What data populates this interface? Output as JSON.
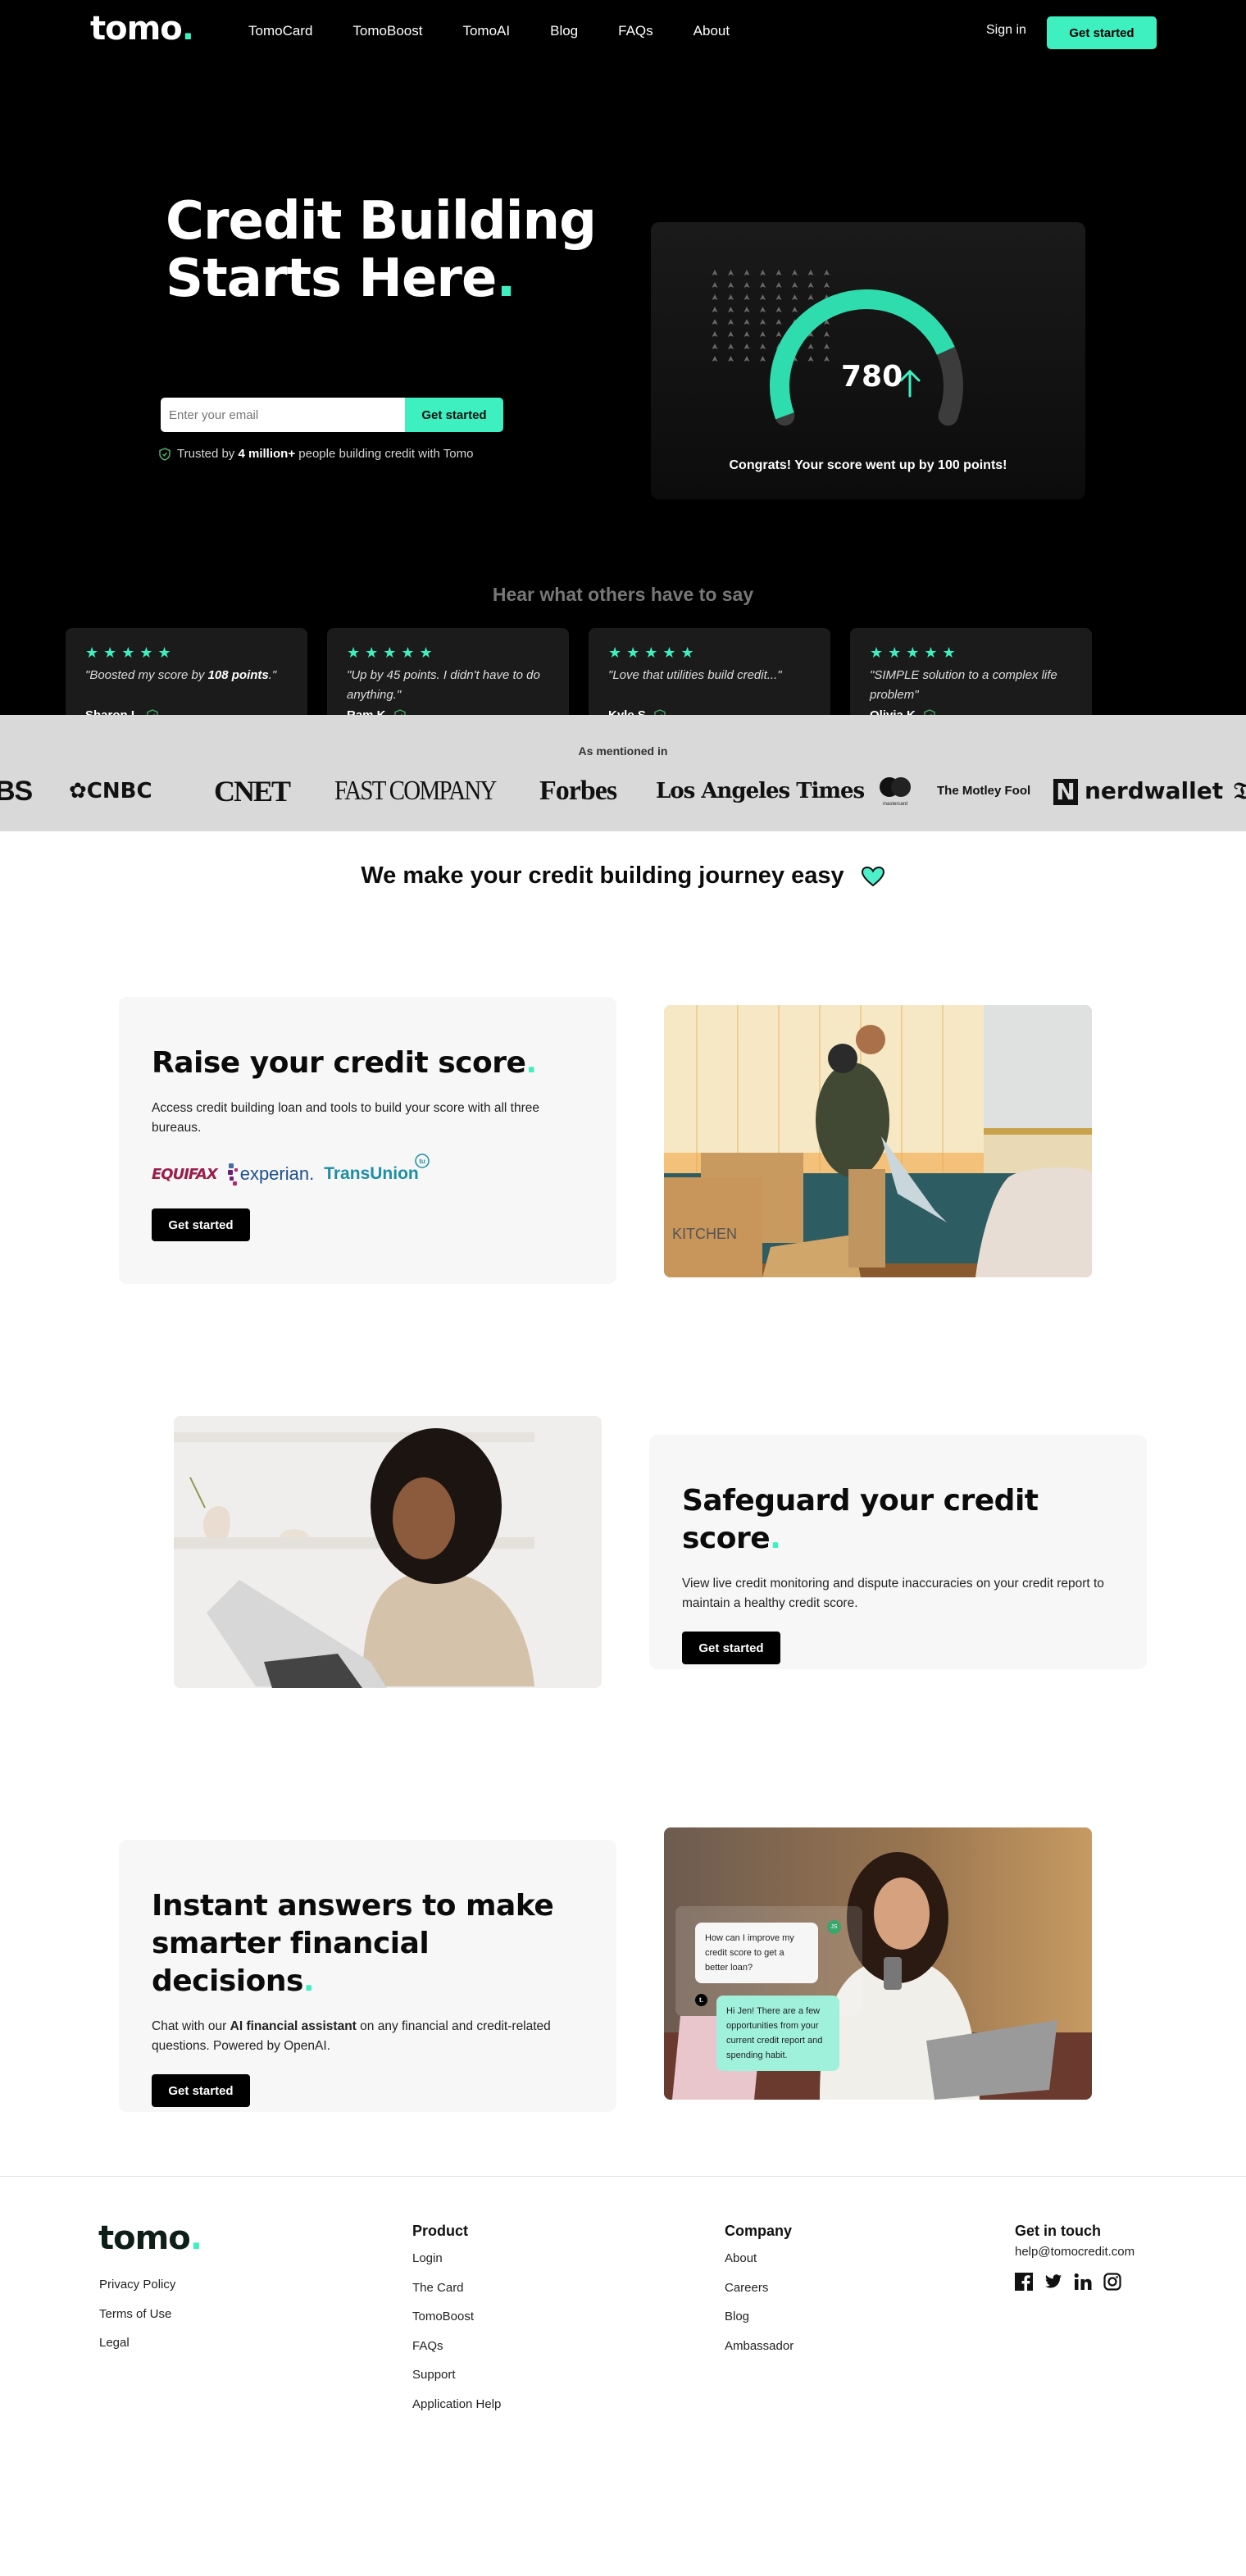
{
  "nav": {
    "logo": "tomo",
    "logo_dot": ".",
    "links": [
      "TomoCard",
      "TomoBoost",
      "TomoAI",
      "Blog",
      "FAQs",
      "About"
    ],
    "sign_in": "Sign in",
    "cta": "Get started"
  },
  "hero": {
    "title_line1": "Credit Building",
    "title_line2": "Starts Here",
    "title_dot": ".",
    "email_placeholder": "Enter your email",
    "email_value": "",
    "email_button": "Get started",
    "trusted_prefix": "Trusted by ",
    "trusted_bold": "4 million+",
    "trusted_suffix": " people building credit with Tomo",
    "score_widget": {
      "score": "780",
      "trend_icon": "arrow-up-icon",
      "gauge_fill_fraction": 0.8,
      "message": "Congrats! Your score went up by 100 points!"
    }
  },
  "testimonials": {
    "title": "Hear what others have to say",
    "rating_stars": 5,
    "items": [
      {
        "stars": "★★★★★",
        "quote_pre": "\"Boosted my score by ",
        "quote_bold": "108 points",
        "quote_post": ".\"",
        "author": "Sharon L."
      },
      {
        "stars": "★★★★★",
        "quote_pre": "\"Up by 45 points. I didn't have to do anything.\"",
        "quote_bold": "",
        "quote_post": "",
        "author": "Ram K."
      },
      {
        "stars": "★★★★★",
        "quote_pre": "\"Love that utilities build credit...\"",
        "quote_bold": "",
        "quote_post": "",
        "author": "Kyle S."
      },
      {
        "stars": "★★★★★",
        "quote_pre": "\"SIMPLE solution to a complex life problem\"",
        "quote_bold": "",
        "quote_post": "",
        "author": "Olivia K."
      }
    ]
  },
  "press": {
    "title": "As mentioned in",
    "logos": [
      "CBS",
      "CNBC",
      "CNET",
      "FAST COMPANY",
      "Forbes",
      "Los Angeles Times",
      "mastercard",
      "The Motley Fool",
      "nerdwallet",
      "The New York Times"
    ]
  },
  "easy": {
    "title": "We make your credit building journey easy",
    "icon": "heart-icon"
  },
  "features": [
    {
      "title": "Raise your credit score",
      "dot": ".",
      "body": "Access credit building loan and tools to build your score with all three bureaus.",
      "bureaus": [
        "EQUIFAX",
        "experian.",
        "TransUnion"
      ],
      "button": "Get started",
      "image": "couple-hugging-moving-boxes-photo"
    },
    {
      "title": "Safeguard your credit score",
      "dot": ".",
      "body": "View live credit monitoring and dispute inaccuracies on your credit report to maintain a healthy credit score.",
      "button": "Get started",
      "image": "woman-using-laptop-photo"
    },
    {
      "title_line1": "Instant answers to make",
      "title_line2": "smarter financial decisions",
      "dot": ".",
      "body_pre": "Chat with our ",
      "body_bold": "AI financial assistant",
      "body_post": " on any financial and credit-related questions. Powered by OpenAI.",
      "button": "Get started",
      "image": "woman-with-phone-photo",
      "chat": {
        "user_avatar": "JS",
        "user_msg": "How can I improve my credit score to get a better loan?",
        "bot_avatar": "t.",
        "bot_msg": "Hi Jen! There are a few opportunities from your current credit report and spending habit."
      }
    }
  ],
  "footer": {
    "logo": "tomo",
    "logo_dot": ".",
    "legal_links": [
      "Privacy Policy",
      "Terms of Use",
      "Legal"
    ],
    "product": {
      "title": "Product",
      "links": [
        "Login",
        "The Card",
        "TomoBoost",
        "FAQs",
        "Support",
        "Application Help"
      ]
    },
    "company": {
      "title": "Company",
      "links": [
        "About",
        "Careers",
        "Blog",
        "Ambassador"
      ]
    },
    "contact": {
      "title": "Get in touch",
      "email": "help@tomocredit.com",
      "social": [
        "facebook-icon",
        "twitter-icon",
        "linkedin-icon",
        "instagram-icon"
      ]
    }
  },
  "colors": {
    "accent": "#3ef0c0",
    "dark": "#000000",
    "card_dark": "#1b1b1b",
    "feature_bg": "#f7f7f7",
    "press_bg": "#d9d9d9"
  }
}
